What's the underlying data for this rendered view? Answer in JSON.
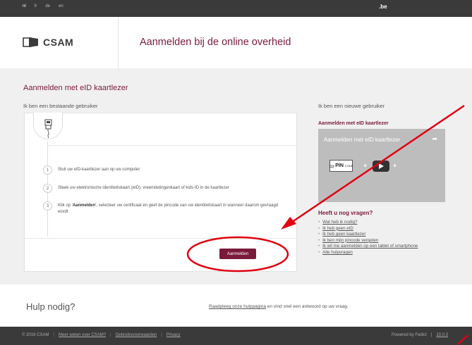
{
  "topbar": {
    "languages": [
      {
        "code": "nl",
        "active": true
      },
      {
        "code": "fr",
        "active": false
      },
      {
        "code": "de",
        "active": false
      },
      {
        "code": "en",
        "active": false
      }
    ],
    "domain": ".be"
  },
  "header": {
    "logo_text": "CSAM",
    "title": "Aanmelden bij de online overheid"
  },
  "main": {
    "title": "Aanmelden met eID kaartlezer",
    "existing_user": "Ik ben een bestaande gebruiker",
    "new_user": "Ik ben een nieuwe gebruiker",
    "steps": [
      {
        "num": "1",
        "text": "Sluit uw eID-kaartlezer aan op uw computer"
      },
      {
        "num": "2",
        "text": "Steek uw elektronische identiteitskaart (eID), vreemdelingenkaart of kids-ID in de kaartlezer"
      },
      {
        "num": "3",
        "text_pre": "Klik op '",
        "text_bold": "Aanmelden",
        "text_post": "', selecteer uw certificaat en geef de pincode van uw identiteitskaart in wanneer daarom gevraagd wordt"
      }
    ],
    "login_button": "Aanmelden"
  },
  "sidebar": {
    "video_heading": "Aanmelden met eID kaartlezer",
    "video_title": "Aanmelden met eID kaartlezer",
    "pin_label": "PIN",
    "pin_sub": "CODE",
    "faq_title": "Heeft u nog vragen?",
    "faq": [
      "Wat heb ik nodig?",
      "Ik heb geen eID",
      "Ik heb geen kaartlezer",
      "Ik ben mijn pincode vergeten",
      "Ik wil me aanmelden op een tablet of smartphone",
      "Alle hulpvragen"
    ]
  },
  "help": {
    "title": "Hulp nodig?",
    "link": "Raadpleeg onze hulppagina",
    "text": " en vind snel een antwoord op uw vraag."
  },
  "footer": {
    "copyright": "© 2016 CSAM",
    "links": [
      "Meer weten over CSAM?",
      "Gebruiksvoorwaarden",
      "Privacy"
    ],
    "powered": "Powered by Fedict",
    "version": "10.0.3"
  },
  "colors": {
    "brand": "#7a1a3a",
    "annotation": "#e0000f"
  }
}
